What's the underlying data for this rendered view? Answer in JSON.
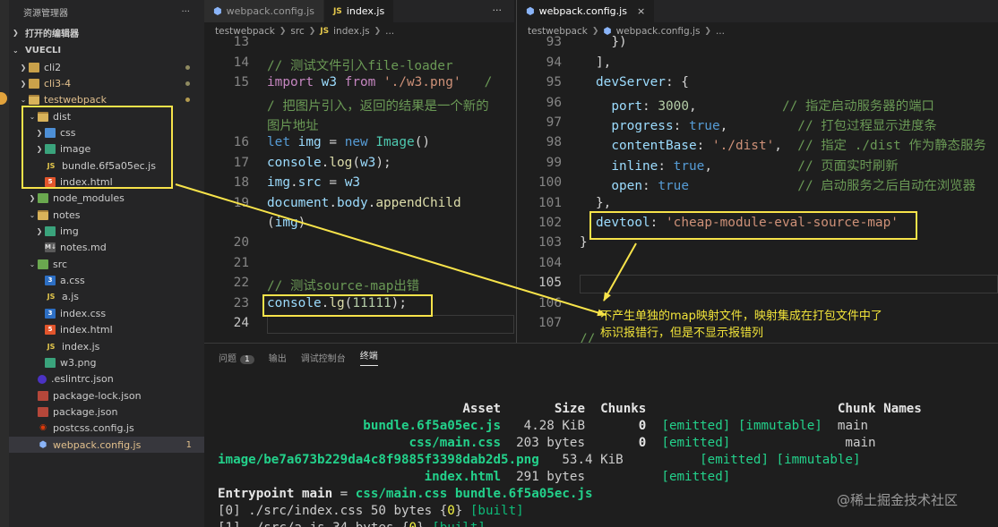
{
  "explorer": {
    "title": "资源管理器",
    "more": "···",
    "open_editors": "打开的编辑器",
    "root": "VUECLI",
    "items": [
      {
        "name": "cli2",
        "badge": ""
      },
      {
        "name": "cli3-4",
        "badge": ""
      },
      {
        "name": "testwebpack",
        "badge": ""
      },
      {
        "name": "dist",
        "badge": ""
      },
      {
        "name": "css",
        "badge": ""
      },
      {
        "name": "image",
        "badge": ""
      },
      {
        "name": "bundle.6f5a05ec.js",
        "badge": ""
      },
      {
        "name": "index.html",
        "badge": ""
      },
      {
        "name": "node_modules",
        "badge": ""
      },
      {
        "name": "notes",
        "badge": ""
      },
      {
        "name": "img",
        "badge": ""
      },
      {
        "name": "notes.md",
        "badge": ""
      },
      {
        "name": "src",
        "badge": ""
      },
      {
        "name": "a.css",
        "badge": ""
      },
      {
        "name": "a.js",
        "badge": ""
      },
      {
        "name": "index.css",
        "badge": ""
      },
      {
        "name": "index.html",
        "badge": ""
      },
      {
        "name": "index.js",
        "badge": ""
      },
      {
        "name": "w3.png",
        "badge": ""
      },
      {
        "name": ".eslintrc.json",
        "badge": ""
      },
      {
        "name": "package-lock.json",
        "badge": ""
      },
      {
        "name": "package.json",
        "badge": ""
      },
      {
        "name": "postcss.config.js",
        "badge": ""
      },
      {
        "name": "webpack.config.js",
        "badge": "1"
      }
    ]
  },
  "left_editor": {
    "tabs": [
      {
        "icon": "gear-icon",
        "label": "webpack.config.js"
      },
      {
        "icon": "JS",
        "label": "index.js"
      }
    ],
    "more": "···",
    "crumbs": [
      "testwebpack",
      "src",
      "index.js",
      "..."
    ],
    "line_numbers": [
      "13",
      "14",
      "15",
      "16",
      "17",
      "18",
      "19",
      "20",
      "21",
      "22",
      "23",
      "24"
    ]
  },
  "right_editor": {
    "tab": {
      "icon": "gear-icon",
      "label": "webpack.config.js",
      "close": "×"
    },
    "crumbs": [
      "testwebpack",
      "webpack.config.js",
      "..."
    ],
    "line_numbers": [
      "93",
      "94",
      "95",
      "96",
      "97",
      "98",
      "99",
      "100",
      "101",
      "102",
      "103",
      "104",
      "105",
      "106",
      "107"
    ]
  },
  "panel": {
    "tabs": [
      {
        "label": "问题",
        "count": "1"
      },
      {
        "label": "输出",
        "count": ""
      },
      {
        "label": "调试控制台",
        "count": ""
      },
      {
        "label": "终端",
        "count": ""
      }
    ]
  },
  "annotation": {
    "note_line1": "不产生单独的map映射文件，映射集成在打包文件中了",
    "note_line2": "标识报错行，但是不显示报错列"
  },
  "watermark": "@稀土掘金技术社区",
  "colors": {
    "highlight": "#f7e34a",
    "terminal_green": "#23d18b",
    "accent_badge": "#e2c08d"
  }
}
